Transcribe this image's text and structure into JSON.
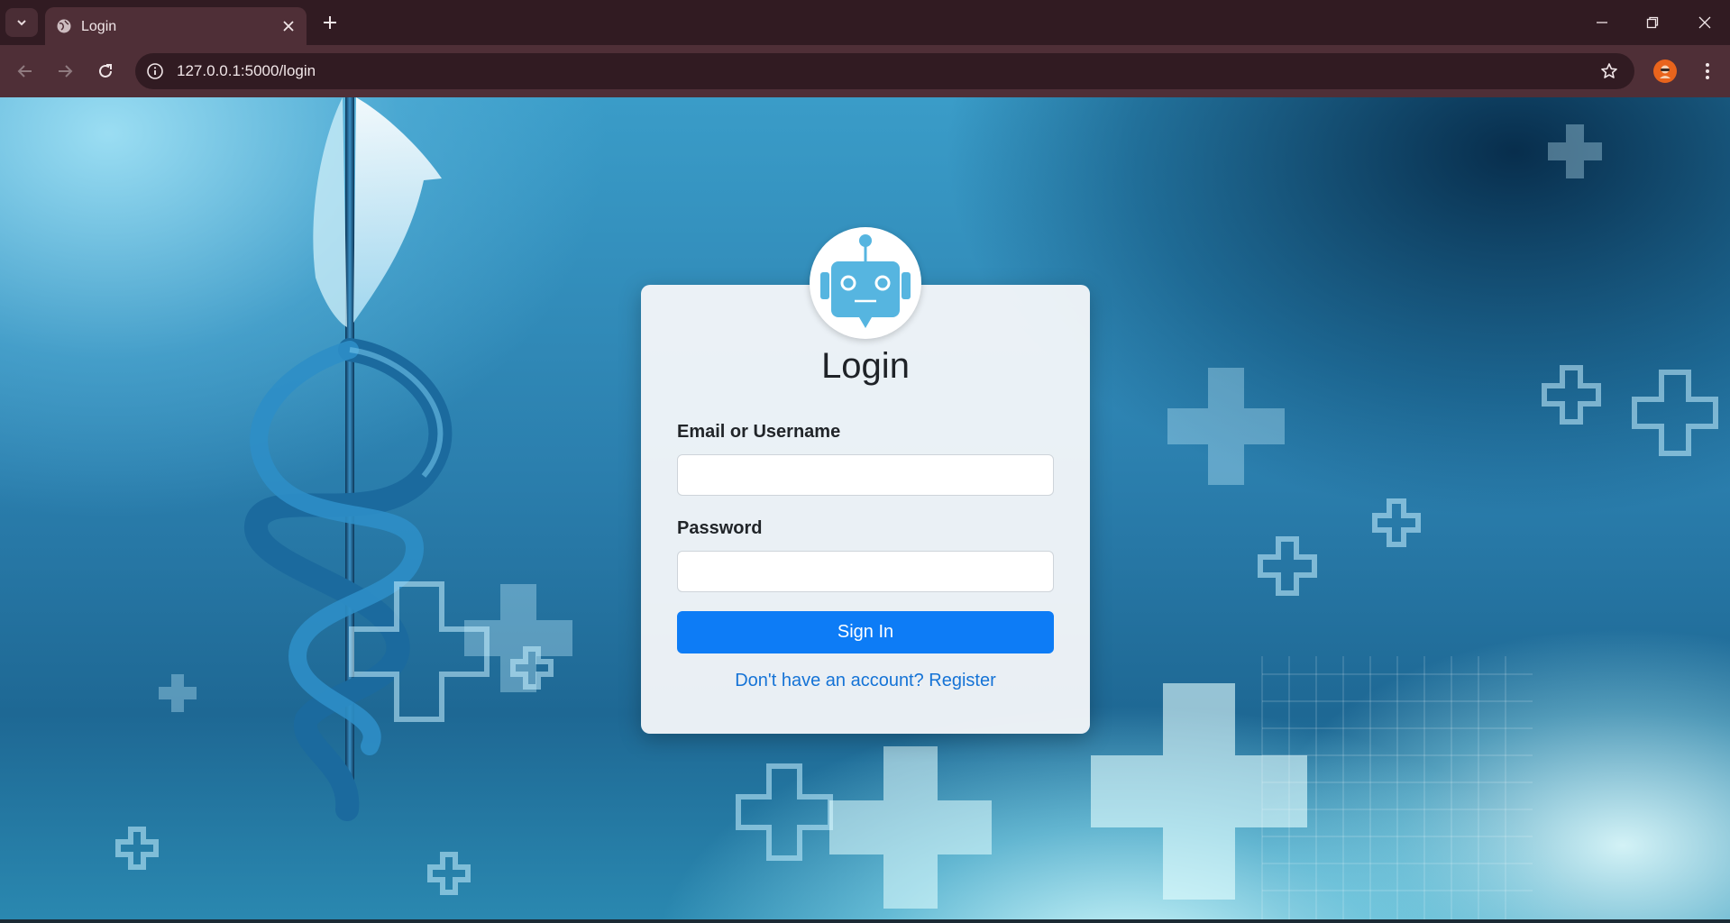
{
  "browser": {
    "tab_title": "Login",
    "url": "127.0.0.1:5000/login",
    "icons": [
      "tab-list-icon",
      "globe-icon",
      "close-icon",
      "plus-icon",
      "minimize-icon",
      "restore-icon",
      "window-close-icon",
      "back-icon",
      "forward-icon",
      "reload-icon",
      "site-info-icon",
      "star-icon",
      "profile-avatar",
      "kebab-menu-icon"
    ]
  },
  "login": {
    "title": "Login",
    "email_label": "Email or Username",
    "email_value": "",
    "password_label": "Password",
    "password_value": "",
    "signin_label": "Sign In",
    "register_link": "Don't have an account? Register",
    "avatar_icon": "robot-icon"
  },
  "colors": {
    "chrome_dark": "#311b22",
    "chrome_mid": "#4f2f37",
    "primary_button": "#0d7cf6",
    "link": "#1573d6",
    "robot_blue": "#56b5e0"
  }
}
